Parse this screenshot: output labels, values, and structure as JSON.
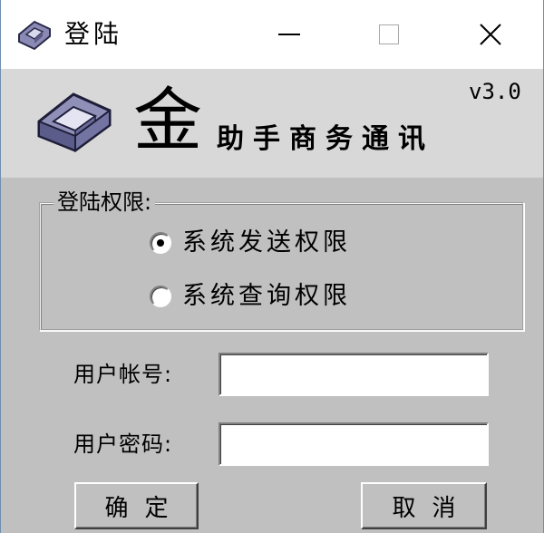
{
  "window": {
    "title": "登陆",
    "icon": "app-logo-icon",
    "controls": {
      "minimize": "minimize-icon",
      "maximize": "maximize-icon",
      "close": "close-icon"
    }
  },
  "banner": {
    "brand_char": "金",
    "tagline": "助手商务通讯",
    "version": "v3.0"
  },
  "permission_group": {
    "legend": "登陆权限:",
    "options": [
      {
        "label": "系统发送权限",
        "selected": true
      },
      {
        "label": "系统查询权限",
        "selected": false
      }
    ]
  },
  "form": {
    "account_label": "用户帐号:",
    "account_value": "",
    "password_label": "用户密码:",
    "password_value": ""
  },
  "buttons": {
    "ok_label": "确定",
    "cancel_label": "取消"
  },
  "colors": {
    "dialog_bg": "#c0c0c0",
    "banner_bg": "#d8d8d8",
    "logo_purple": "#8f8fb8"
  }
}
